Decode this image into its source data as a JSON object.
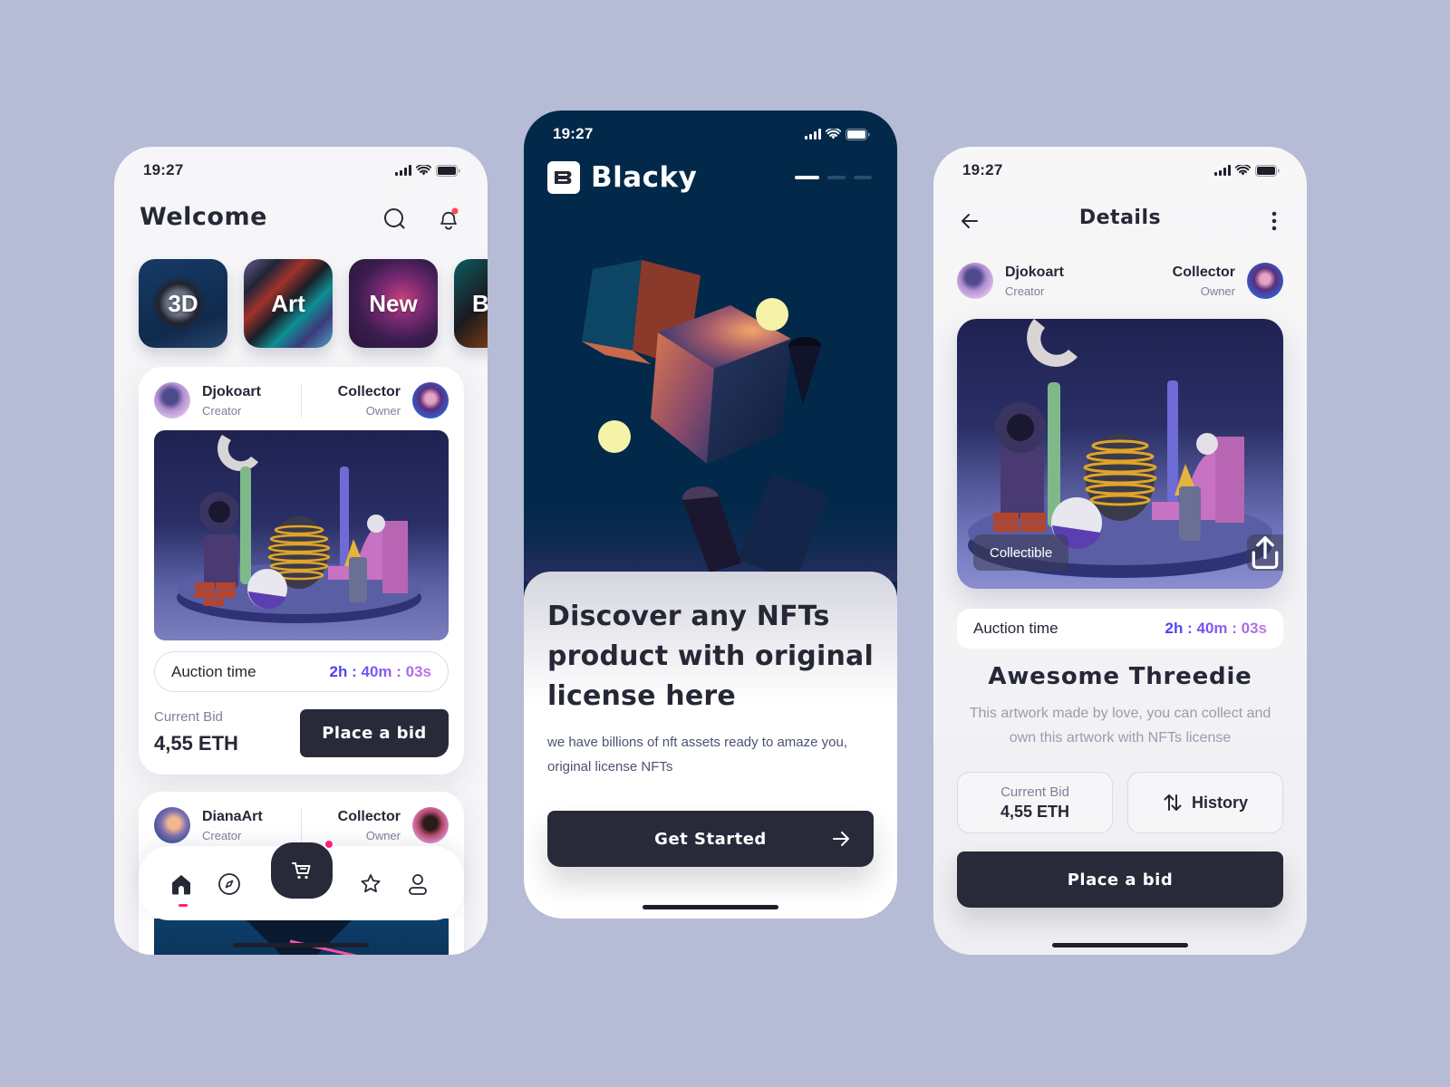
{
  "colors": {
    "background": "#b6bbd6",
    "dark": "#282a3a",
    "accent_pink": "#ff1f7a",
    "timer_start": "#3f3ef5",
    "timer_end": "#c774e6",
    "onboarding_bg": "#02294a",
    "moon_yellow": "#f4f3a8"
  },
  "status_bar": {
    "time": "19:27",
    "icons": [
      "signal-icon",
      "wifi-icon",
      "battery-icon"
    ]
  },
  "home_screen": {
    "title": "Welcome",
    "header_icons": [
      "search-icon",
      "bell-icon"
    ],
    "notification_dot": true,
    "categories": [
      {
        "label": "3D"
      },
      {
        "label": "Art"
      },
      {
        "label": "New"
      },
      {
        "label": "Be"
      }
    ],
    "cards": [
      {
        "creator": {
          "name": "Djokoart",
          "role": "Creator"
        },
        "owner": {
          "name": "Collector",
          "role": "Owner"
        },
        "auction_label": "Auction time",
        "auction_time": "2h : 40m : 03s",
        "bid_label": "Current Bid",
        "bid_value": "4,55 ETH",
        "button": "Place a bid"
      },
      {
        "creator": {
          "name": "DianaArt",
          "role": "Creator"
        },
        "owner": {
          "name": "Collector",
          "role": "Owner"
        }
      }
    ],
    "bottom_nav": [
      {
        "icon": "home-icon",
        "active": true
      },
      {
        "icon": "compass-icon",
        "active": false
      },
      {
        "icon": "cart-icon",
        "active": false,
        "badge": true
      },
      {
        "icon": "star-icon",
        "active": false
      },
      {
        "icon": "profile-icon",
        "active": false
      }
    ]
  },
  "onboarding_screen": {
    "logo_letter": "B",
    "brand": "Blacky",
    "page_indicator": {
      "total": 3,
      "current": 1
    },
    "headline": "Discover any NFTs product with original license here",
    "subtext": "we have billions of nft assets ready to amaze you, original license NFTs",
    "button": "Get Started"
  },
  "details_screen": {
    "title": "Details",
    "creator": {
      "name": "Djokoart",
      "role": "Creator"
    },
    "owner": {
      "name": "Collector",
      "role": "Owner"
    },
    "tag": "Collectible",
    "auction_label": "Auction time",
    "auction_time": "2h : 40m : 03s",
    "artwork_title": "Awesome Threedie",
    "description": "This artwork made by love, you can collect and own this artwork with NFTs license",
    "bid_label": "Current Bid",
    "bid_value": "4,55 ETH",
    "history_label": "History",
    "button": "Place a bid"
  }
}
